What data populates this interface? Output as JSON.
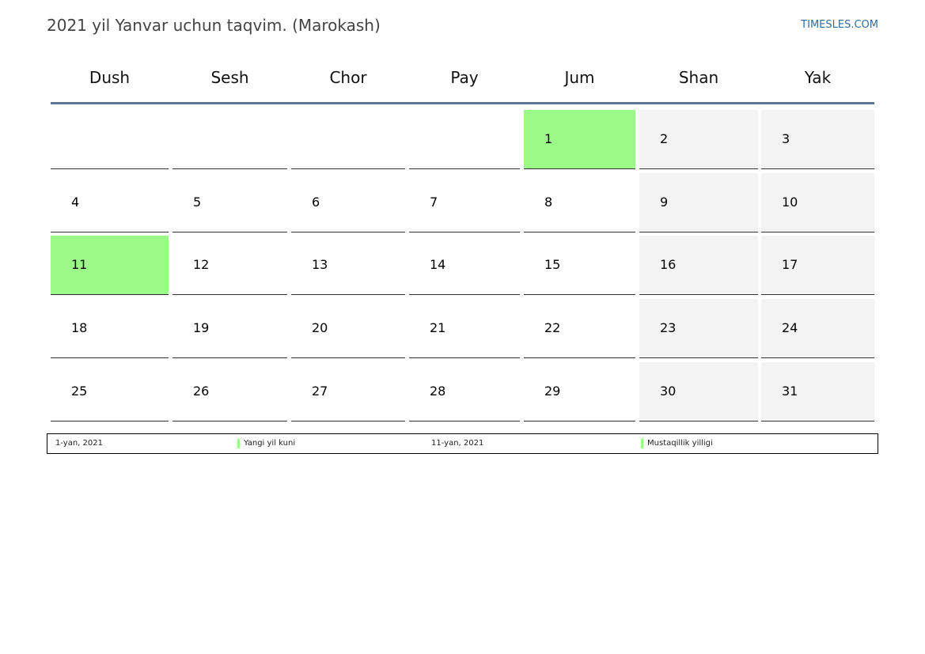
{
  "header": {
    "title": "2021 yil Yanvar uchun taqvim. (Marokash)",
    "site": "TIMESLES.COM"
  },
  "weekdays": [
    "Dush",
    "Sesh",
    "Chor",
    "Pay",
    "Jum",
    "Shan",
    "Yak"
  ],
  "weeks": [
    [
      "",
      "",
      "",
      "",
      "1",
      "2",
      "3"
    ],
    [
      "4",
      "5",
      "6",
      "7",
      "8",
      "9",
      "10"
    ],
    [
      "11",
      "12",
      "13",
      "14",
      "15",
      "16",
      "17"
    ],
    [
      "18",
      "19",
      "20",
      "21",
      "22",
      "23",
      "24"
    ],
    [
      "25",
      "26",
      "27",
      "28",
      "29",
      "30",
      "31"
    ]
  ],
  "holidays": [
    "1",
    "11"
  ],
  "colors": {
    "holiday": "#9cfa88",
    "weekend": "#f3f3f3",
    "header_rule": "#5a7497",
    "site_link": "#2e6da4"
  },
  "legend": [
    {
      "date": "1-yan, 2021",
      "name": "Yangi yil kuni"
    },
    {
      "date": "11-yan, 2021",
      "name": "Mustaqillik yilligi"
    }
  ]
}
